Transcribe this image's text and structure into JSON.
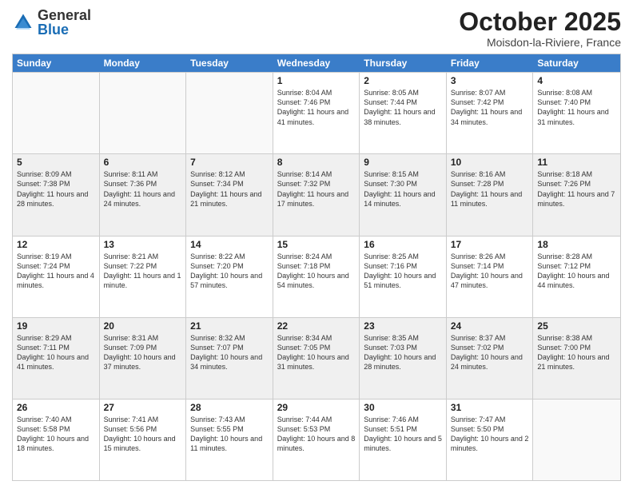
{
  "logo": {
    "general": "General",
    "blue": "Blue"
  },
  "title": "October 2025",
  "location": "Moisdon-la-Riviere, France",
  "header_days": [
    "Sunday",
    "Monday",
    "Tuesday",
    "Wednesday",
    "Thursday",
    "Friday",
    "Saturday"
  ],
  "rows": [
    [
      {
        "day": "",
        "info": "",
        "empty": true
      },
      {
        "day": "",
        "info": "",
        "empty": true
      },
      {
        "day": "",
        "info": "",
        "empty": true
      },
      {
        "day": "1",
        "info": "Sunrise: 8:04 AM\nSunset: 7:46 PM\nDaylight: 11 hours\nand 41 minutes."
      },
      {
        "day": "2",
        "info": "Sunrise: 8:05 AM\nSunset: 7:44 PM\nDaylight: 11 hours\nand 38 minutes."
      },
      {
        "day": "3",
        "info": "Sunrise: 8:07 AM\nSunset: 7:42 PM\nDaylight: 11 hours\nand 34 minutes."
      },
      {
        "day": "4",
        "info": "Sunrise: 8:08 AM\nSunset: 7:40 PM\nDaylight: 11 hours\nand 31 minutes."
      }
    ],
    [
      {
        "day": "5",
        "info": "Sunrise: 8:09 AM\nSunset: 7:38 PM\nDaylight: 11 hours\nand 28 minutes.",
        "shaded": true
      },
      {
        "day": "6",
        "info": "Sunrise: 8:11 AM\nSunset: 7:36 PM\nDaylight: 11 hours\nand 24 minutes.",
        "shaded": true
      },
      {
        "day": "7",
        "info": "Sunrise: 8:12 AM\nSunset: 7:34 PM\nDaylight: 11 hours\nand 21 minutes.",
        "shaded": true
      },
      {
        "day": "8",
        "info": "Sunrise: 8:14 AM\nSunset: 7:32 PM\nDaylight: 11 hours\nand 17 minutes.",
        "shaded": true
      },
      {
        "day": "9",
        "info": "Sunrise: 8:15 AM\nSunset: 7:30 PM\nDaylight: 11 hours\nand 14 minutes.",
        "shaded": true
      },
      {
        "day": "10",
        "info": "Sunrise: 8:16 AM\nSunset: 7:28 PM\nDaylight: 11 hours\nand 11 minutes.",
        "shaded": true
      },
      {
        "day": "11",
        "info": "Sunrise: 8:18 AM\nSunset: 7:26 PM\nDaylight: 11 hours\nand 7 minutes.",
        "shaded": true
      }
    ],
    [
      {
        "day": "12",
        "info": "Sunrise: 8:19 AM\nSunset: 7:24 PM\nDaylight: 11 hours\nand 4 minutes."
      },
      {
        "day": "13",
        "info": "Sunrise: 8:21 AM\nSunset: 7:22 PM\nDaylight: 11 hours\nand 1 minute."
      },
      {
        "day": "14",
        "info": "Sunrise: 8:22 AM\nSunset: 7:20 PM\nDaylight: 10 hours\nand 57 minutes."
      },
      {
        "day": "15",
        "info": "Sunrise: 8:24 AM\nSunset: 7:18 PM\nDaylight: 10 hours\nand 54 minutes."
      },
      {
        "day": "16",
        "info": "Sunrise: 8:25 AM\nSunset: 7:16 PM\nDaylight: 10 hours\nand 51 minutes."
      },
      {
        "day": "17",
        "info": "Sunrise: 8:26 AM\nSunset: 7:14 PM\nDaylight: 10 hours\nand 47 minutes."
      },
      {
        "day": "18",
        "info": "Sunrise: 8:28 AM\nSunset: 7:12 PM\nDaylight: 10 hours\nand 44 minutes."
      }
    ],
    [
      {
        "day": "19",
        "info": "Sunrise: 8:29 AM\nSunset: 7:11 PM\nDaylight: 10 hours\nand 41 minutes.",
        "shaded": true
      },
      {
        "day": "20",
        "info": "Sunrise: 8:31 AM\nSunset: 7:09 PM\nDaylight: 10 hours\nand 37 minutes.",
        "shaded": true
      },
      {
        "day": "21",
        "info": "Sunrise: 8:32 AM\nSunset: 7:07 PM\nDaylight: 10 hours\nand 34 minutes.",
        "shaded": true
      },
      {
        "day": "22",
        "info": "Sunrise: 8:34 AM\nSunset: 7:05 PM\nDaylight: 10 hours\nand 31 minutes.",
        "shaded": true
      },
      {
        "day": "23",
        "info": "Sunrise: 8:35 AM\nSunset: 7:03 PM\nDaylight: 10 hours\nand 28 minutes.",
        "shaded": true
      },
      {
        "day": "24",
        "info": "Sunrise: 8:37 AM\nSunset: 7:02 PM\nDaylight: 10 hours\nand 24 minutes.",
        "shaded": true
      },
      {
        "day": "25",
        "info": "Sunrise: 8:38 AM\nSunset: 7:00 PM\nDaylight: 10 hours\nand 21 minutes.",
        "shaded": true
      }
    ],
    [
      {
        "day": "26",
        "info": "Sunrise: 7:40 AM\nSunset: 5:58 PM\nDaylight: 10 hours\nand 18 minutes."
      },
      {
        "day": "27",
        "info": "Sunrise: 7:41 AM\nSunset: 5:56 PM\nDaylight: 10 hours\nand 15 minutes."
      },
      {
        "day": "28",
        "info": "Sunrise: 7:43 AM\nSunset: 5:55 PM\nDaylight: 10 hours\nand 11 minutes."
      },
      {
        "day": "29",
        "info": "Sunrise: 7:44 AM\nSunset: 5:53 PM\nDaylight: 10 hours\nand 8 minutes."
      },
      {
        "day": "30",
        "info": "Sunrise: 7:46 AM\nSunset: 5:51 PM\nDaylight: 10 hours\nand 5 minutes."
      },
      {
        "day": "31",
        "info": "Sunrise: 7:47 AM\nSunset: 5:50 PM\nDaylight: 10 hours\nand 2 minutes."
      },
      {
        "day": "",
        "info": "",
        "empty": true
      }
    ]
  ]
}
